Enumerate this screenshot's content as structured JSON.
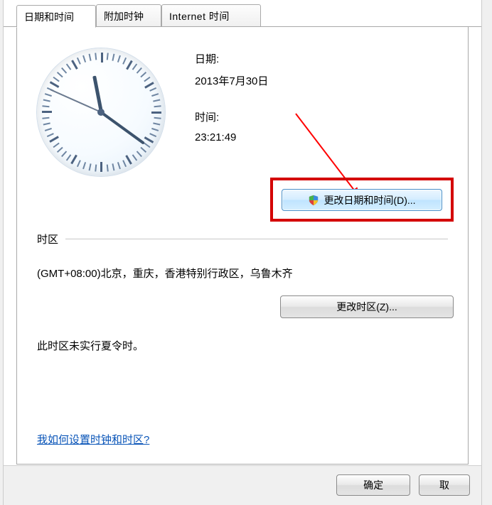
{
  "tabs": {
    "datetime": "日期和时间",
    "clocks": "附加时钟",
    "internet": "Internet 时间"
  },
  "main": {
    "date_label": "日期:",
    "date_value": "2013年7月30日",
    "time_label": "时间:",
    "time_value": "23:21:49",
    "change_datetime": "更改日期和时间(D)...",
    "tz_header": "时区",
    "tz_value": "(GMT+08:00)北京，重庆，香港特别行政区，乌鲁木齐",
    "change_tz": "更改时区(Z)...",
    "dst_info": "此时区未实行夏令时。",
    "help_link": "我如何设置时钟和时区?"
  },
  "buttons": {
    "ok": "确定",
    "cancel": "取"
  },
  "clock": {
    "hour": 23,
    "minute": 21,
    "second": 49
  },
  "annotation": {
    "highlight_color": "#d40000",
    "arrow_color": "#ff0000"
  }
}
